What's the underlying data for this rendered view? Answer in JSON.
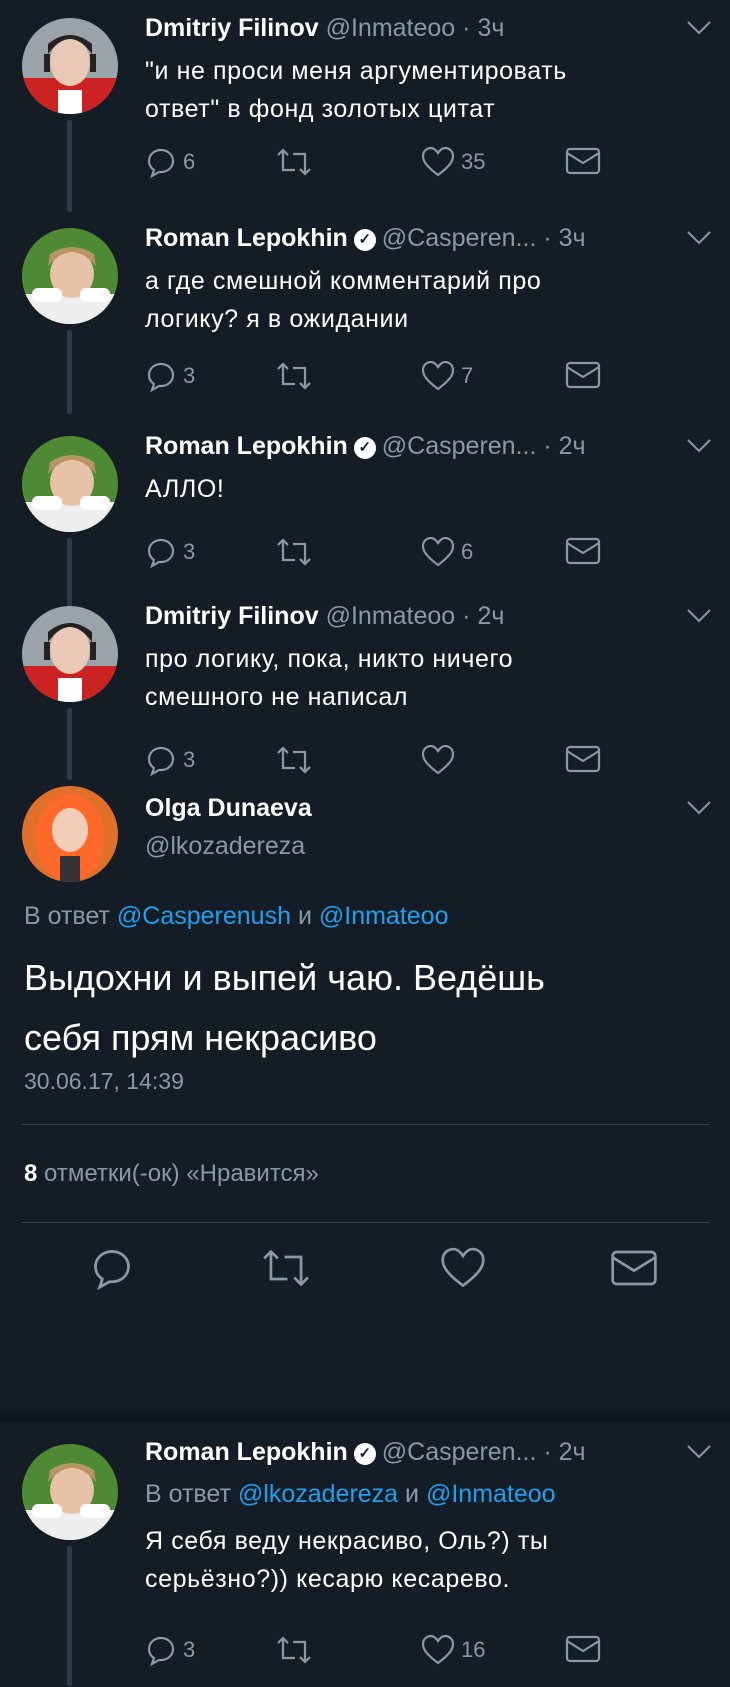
{
  "tweets": [
    {
      "name": "Dmitriy Filinov",
      "handle": "@Inmateoo",
      "time": "3ч",
      "lines": [
        "\"и не проси меня аргументировать",
        "ответ\" в фонд золотых цитат"
      ],
      "replies": "6",
      "likes": "35"
    },
    {
      "name": "Roman Lepokhin",
      "handle": "@Casperen...",
      "time": "3ч",
      "lines": [
        "а где смешной комментарий про",
        "логику? я в ожидании"
      ],
      "replies": "3",
      "likes": "7"
    },
    {
      "name": "Roman Lepokhin",
      "handle": "@Casperen...",
      "time": "2ч",
      "lines": [
        "АЛЛО!"
      ],
      "replies": "3",
      "likes": "6"
    },
    {
      "name": "Dmitriy Filinov",
      "handle": "@Inmateoo",
      "time": "2ч",
      "lines": [
        "про логику, пока, никто ничего",
        "смешного не написал"
      ],
      "replies": "3",
      "likes": ""
    }
  ],
  "focus": {
    "name": "Olga Dunaeva",
    "handle": "@lkozadereza",
    "reply_prefix": "В ответ",
    "reply_to_1": "@Casperenush",
    "reply_and": "и",
    "reply_to_2": "@Inmateoo",
    "text_line1": "Выдохни и выпей чаю. Ведёшь",
    "text_line2": "себя прям некрасиво",
    "timestamp": "30.06.17, 14:39",
    "likes_count": "8",
    "likes_label": "отметки(-ок) «Нравится»"
  },
  "last": {
    "name": "Roman Lepokhin",
    "handle": "@Casperen...",
    "time": "2ч",
    "reply_prefix": "В ответ",
    "reply_to_1": "@lkozadereza",
    "reply_and": "и",
    "reply_to_2": "@Inmateoo",
    "line1": "Я себя веду некрасиво, Оль?) ты",
    "line2": "серьёзно?)) кесарю кесарево.",
    "replies": "3",
    "likes": "16"
  },
  "icons": {
    "reply": "reply-icon",
    "retweet": "retweet-icon",
    "like": "heart-icon",
    "dm": "envelope-icon",
    "more": "chevron-down-icon",
    "verified": "verified-badge-icon"
  },
  "colors": {
    "background": "#141d26",
    "muted": "#8899a6",
    "link": "#1da1f2",
    "divider": "#38444d"
  }
}
